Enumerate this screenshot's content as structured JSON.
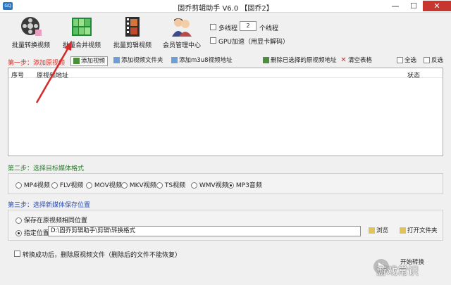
{
  "window": {
    "title": "固乔剪辑助手 V6.0 【固乔2】",
    "icon_label": "GQ"
  },
  "toolbar": {
    "buttons": [
      {
        "label": "批量转换视频",
        "icon": "film-reel-icon"
      },
      {
        "label": "批量合并视频",
        "icon": "merge-tiles-icon"
      },
      {
        "label": "批量剪辑视频",
        "icon": "film-strip-icon"
      },
      {
        "label": "会员管理中心",
        "icon": "users-icon"
      }
    ],
    "multithread_label": "多线程",
    "thread_count": "2",
    "thread_unit": "个线程",
    "gpu_label": "GPU加速（用显卡解码）"
  },
  "step1": {
    "label": "第一步：添加原视频",
    "add_video": "添加视频",
    "add_folder": "添加视频文件夹",
    "add_m3u8": "添加m3u8视频地址",
    "delete_selected": "删除已选择的原视频地址",
    "clear_table": "清空表格",
    "select_all": "全选",
    "invert": "反选"
  },
  "table": {
    "columns": [
      "序号",
      "原视频地址",
      "状态"
    ]
  },
  "step2": {
    "label": "第二步：选择目标媒体格式",
    "formats": [
      "MP4视频",
      "FLV视频",
      "MOV视频",
      "MKV视频",
      "TS视频",
      "WMV视频",
      "MP3音频"
    ],
    "selected": "MP3音频"
  },
  "step3": {
    "label": "第三步：选择新媒体保存位置",
    "option_same": "保存在原视频相同位置",
    "option_custom": "指定位置",
    "path": "D:\\固乔剪辑助手\\剪辑\\转换格式",
    "browse": "浏览",
    "open_folder": "打开文件夹"
  },
  "footer": {
    "delete_after": "转换成功后，删除原视频文件（删除后的文件不能恢复）",
    "start": "开始转换",
    "watermark": "游戏常识"
  },
  "colors": {
    "arrow": "#d62a2a",
    "step1": "#d6312a",
    "step2": "#2a7f2a",
    "step3": "#2b4fb3"
  }
}
